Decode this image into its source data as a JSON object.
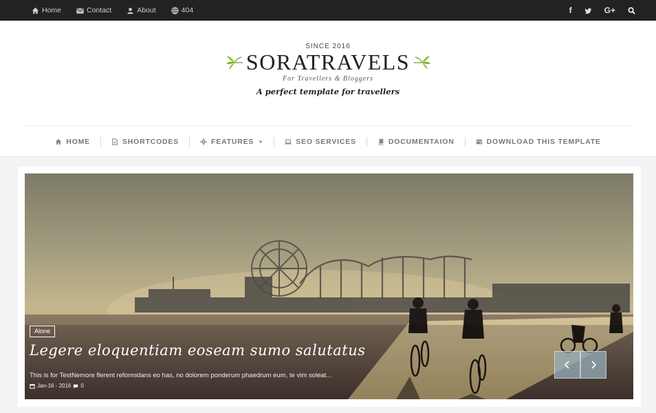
{
  "topbar": {
    "links": [
      {
        "label": "Home",
        "icon": "home-icon"
      },
      {
        "label": "Contact",
        "icon": "envelope-icon"
      },
      {
        "label": "About",
        "icon": "user-icon"
      },
      {
        "label": "404",
        "icon": "globe-icon"
      }
    ],
    "social": [
      "facebook-icon",
      "twitter-icon",
      "google-plus-icon",
      "search-icon"
    ],
    "social_labels": {
      "facebook": "f",
      "google": "G+"
    }
  },
  "header": {
    "since": "SINCE 2016",
    "brand": "SORATRAVELS",
    "subtag": "For Travellers & Bloggers",
    "tagline": "A perfect template for travellers"
  },
  "mainnav": {
    "items": [
      {
        "label": "HOME",
        "icon": "home-icon"
      },
      {
        "label": "SHORTCODES",
        "icon": "file-icon"
      },
      {
        "label": "FEATURES",
        "icon": "gear-icon"
      },
      {
        "label": "SEO SERVICES",
        "icon": "laptop-icon"
      },
      {
        "label": "DOCUMENTAION",
        "icon": "book-icon"
      },
      {
        "label": "DOWNLOAD THIS TEMPLATE",
        "icon": "download-icon"
      }
    ]
  },
  "slider": {
    "label": "Alone",
    "title": "Legere eloquentiam eoseam sumo salutatus",
    "excerpt": "This is for TestNemore flerent reformidans eo has, no dolorem ponderum phaedrum eum, te vim soleat...",
    "date": "Jan-16 - 2016",
    "comments": "0"
  },
  "colors": {
    "topbar_bg": "#222222",
    "nav_text": "#777777",
    "leaf_green": "#8cc63f",
    "arrow_bg": "#96afb9"
  }
}
